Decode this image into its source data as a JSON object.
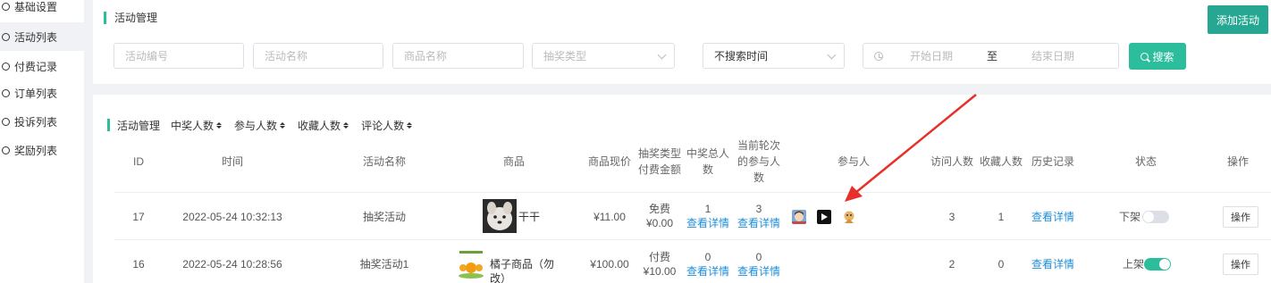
{
  "sidebar": {
    "items": [
      {
        "label": "基础设置"
      },
      {
        "label": "活动列表"
      },
      {
        "label": "付费记录"
      },
      {
        "label": "订单列表"
      },
      {
        "label": "投诉列表"
      },
      {
        "label": "奖励列表"
      }
    ]
  },
  "header": {
    "title": "活动管理",
    "add_button": "添加活动"
  },
  "filters": {
    "activity_no_placeholder": "活动编号",
    "activity_name_placeholder": "活动名称",
    "product_name_placeholder": "商品名称",
    "lottery_type_placeholder": "抽奖类型",
    "time_filter_value": "不搜索时间",
    "start_date_placeholder": "开始日期",
    "date_separator": "至",
    "end_date_placeholder": "结束日期",
    "search_button": "搜索"
  },
  "table": {
    "title": "活动管理",
    "sorts": [
      "中奖人数",
      "参与人数",
      "收藏人数",
      "评论人数"
    ],
    "columns": {
      "id": "ID",
      "time": "时间",
      "name": "活动名称",
      "product": "商品",
      "price": "商品现价",
      "lottery_type_l1": "抽奖类型",
      "lottery_type_l2": "付费金额",
      "winners_l1": "中奖总人",
      "winners_l2": "数",
      "round_l1": "当前轮次",
      "round_l2": "的参与人",
      "round_l3": "数",
      "participants": "参与人",
      "visits": "访问人数",
      "favorites": "收藏人数",
      "history": "历史记录",
      "status": "状态",
      "ops": "操作"
    },
    "rows": [
      {
        "id": "17",
        "time": "2022-05-24 10:32:13",
        "name": "抽奖活动",
        "product": "干干",
        "price": "¥11.00",
        "type": "免费",
        "fee": "¥0.00",
        "winners": "1",
        "winners_link": "查看详情",
        "round": "3",
        "round_link": "查看详情",
        "visits": "3",
        "favorites": "1",
        "history": "查看详情",
        "status": "下架",
        "on": false,
        "op": "操作"
      },
      {
        "id": "16",
        "time": "2022-05-24 10:28:56",
        "name": "抽奖活动1",
        "product": "橘子商品（勿改）",
        "price": "¥100.00",
        "type": "付费",
        "fee": "¥10.00",
        "winners": "0",
        "winners_link": "查看详情",
        "round": "0",
        "round_link": "查看详情",
        "visits": "2",
        "favorites": "0",
        "history": "查看详情",
        "status": "上架",
        "on": true,
        "op": "操作"
      }
    ]
  },
  "colors": {
    "accent": "#2bbd9c",
    "link": "#1f8ed8",
    "annotation_arrow": "#e8302a"
  }
}
